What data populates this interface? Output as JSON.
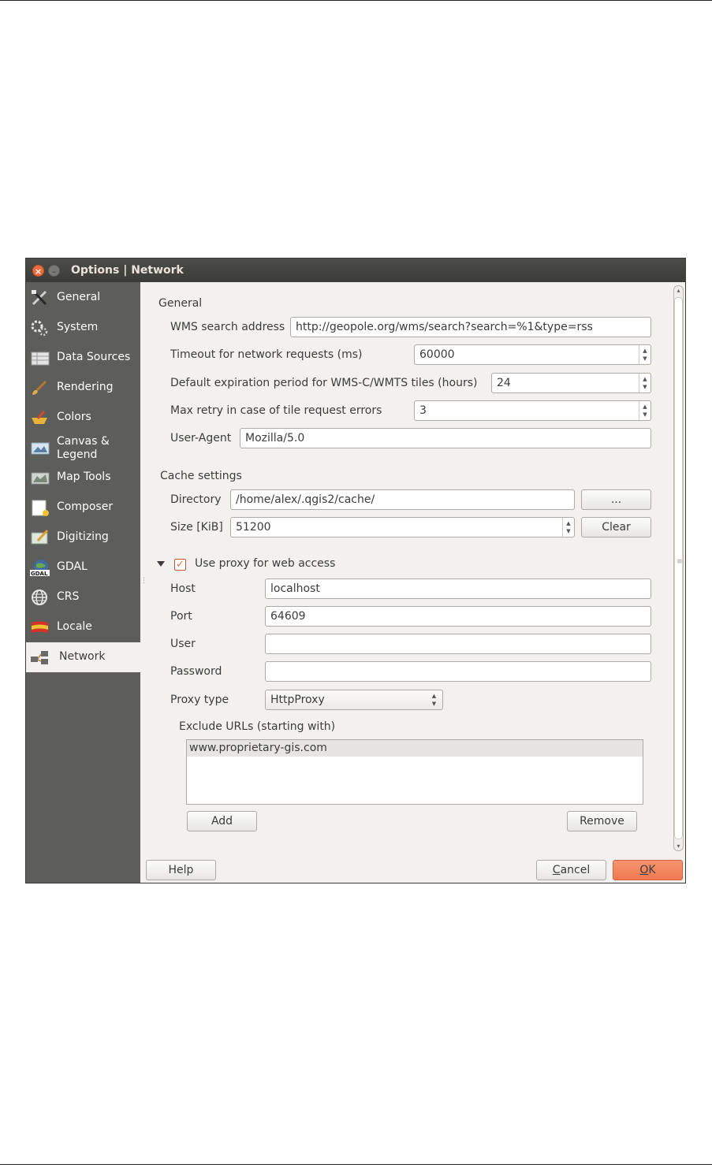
{
  "window": {
    "title": "Options | Network"
  },
  "sidebar": {
    "items": [
      {
        "label": "General",
        "icon": "tools-icon"
      },
      {
        "label": "System",
        "icon": "gears-icon"
      },
      {
        "label": "Data Sources",
        "icon": "table-icon"
      },
      {
        "label": "Rendering",
        "icon": "brush-icon"
      },
      {
        "label": "Colors",
        "icon": "palette-icon"
      },
      {
        "label": "Canvas & Legend",
        "icon": "canvas-icon"
      },
      {
        "label": "Map Tools",
        "icon": "map-tools-icon"
      },
      {
        "label": "Composer",
        "icon": "composer-icon"
      },
      {
        "label": "Digitizing",
        "icon": "digitizing-icon"
      },
      {
        "label": "GDAL",
        "icon": "gdal-icon"
      },
      {
        "label": "CRS",
        "icon": "globe-icon"
      },
      {
        "label": "Locale",
        "icon": "flag-icon"
      },
      {
        "label": "Network",
        "icon": "network-icon"
      }
    ],
    "active": "Network"
  },
  "general": {
    "heading": "General",
    "wms_label": "WMS search address",
    "wms_value": "http://geopole.org/wms/search?search=%1&type=rss",
    "timeout_label": "Timeout for network requests (ms)",
    "timeout_value": "60000",
    "expiration_label": "Default expiration period for WMS-C/WMTS tiles (hours)",
    "expiration_value": "24",
    "retry_label": "Max retry in case of tile request errors",
    "retry_value": "3",
    "useragent_label": "User-Agent",
    "useragent_value": "Mozilla/5.0"
  },
  "cache": {
    "heading": "Cache settings",
    "directory_label": "Directory",
    "directory_value": "/home/alex/.qgis2/cache/",
    "browse_label": "...",
    "size_label": "Size [KiB]",
    "size_value": "51200",
    "clear_label": "Clear"
  },
  "proxy": {
    "checkbox_label": "Use proxy for web access",
    "checked": true,
    "host_label": "Host",
    "host_value": "localhost",
    "port_label": "Port",
    "port_value": "64609",
    "user_label": "User",
    "user_value": "",
    "password_label": "Password",
    "password_value": "",
    "type_label": "Proxy type",
    "type_value": "HttpProxy",
    "exclude_label": "Exclude URLs (starting with)",
    "exclude_urls": [
      "www.proprietary-gis.com"
    ],
    "add_label": "Add",
    "remove_label": "Remove"
  },
  "footer": {
    "help_label": "Help",
    "cancel_first": "C",
    "cancel_rest": "ancel",
    "ok_first": "O",
    "ok_rest": "K"
  },
  "colors": {
    "accent": "#ef6c3f",
    "sidebar": "#5d5d5b",
    "titlebar": "#3b3b38"
  }
}
